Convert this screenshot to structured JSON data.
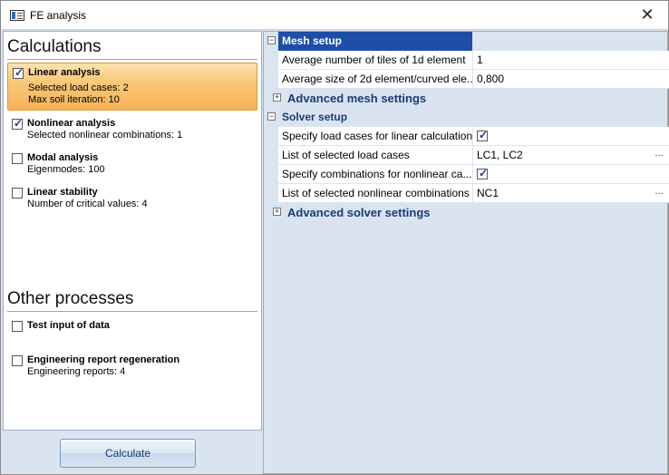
{
  "window": {
    "title": "FE analysis",
    "close_glyph": "✕"
  },
  "calculations": {
    "header": "Calculations",
    "items": [
      {
        "title": "Linear analysis",
        "lines": [
          "Selected load cases: 2",
          "Max soil iteration: 10"
        ],
        "checked": true,
        "selected": true
      },
      {
        "title": "Nonlinear analysis",
        "lines": [
          "Selected nonlinear combinations: 1"
        ],
        "checked": true,
        "selected": false
      },
      {
        "title": "Modal analysis",
        "lines": [
          "Eigenmodes: 100"
        ],
        "checked": false,
        "selected": false
      },
      {
        "title": "Linear stability",
        "lines": [
          "Number of critical values: 4"
        ],
        "checked": false,
        "selected": false
      }
    ]
  },
  "other_processes": {
    "header": "Other processes",
    "items": [
      {
        "title": "Test input of data",
        "lines": [],
        "checked": false
      },
      {
        "title": "Engineering report regeneration",
        "lines": [
          "Engineering reports: 4"
        ],
        "checked": false
      }
    ]
  },
  "calculate_button": "Calculate",
  "grid": {
    "mesh_setup": {
      "label": "Mesh setup",
      "expander": "−",
      "props": [
        {
          "name": "Average number of tiles of 1d element",
          "value": "1"
        },
        {
          "name": "Average size of 2d element/curved ele...",
          "value": "0,800"
        }
      ]
    },
    "advanced_mesh": {
      "label": "Advanced mesh settings",
      "expander": "+"
    },
    "solver_setup": {
      "label": "Solver setup",
      "expander": "−",
      "props": [
        {
          "name": "Specify load cases for linear calculation",
          "checked": true
        },
        {
          "name": "List of selected load cases",
          "value": "LC1, LC2",
          "ellipsis": "..."
        },
        {
          "name": "Specify combinations for nonlinear ca...",
          "checked": true
        },
        {
          "name": "List of selected nonlinear combinations",
          "value": "NC1",
          "ellipsis": "..."
        }
      ]
    },
    "advanced_solver": {
      "label": "Advanced solver settings",
      "expander": "+"
    }
  },
  "colors": {
    "selection_orange": "#f6b257",
    "grid_selection_blue": "#1e4ea8",
    "category_text": "#1b3a78",
    "panel_background": "#d9e4f0"
  }
}
